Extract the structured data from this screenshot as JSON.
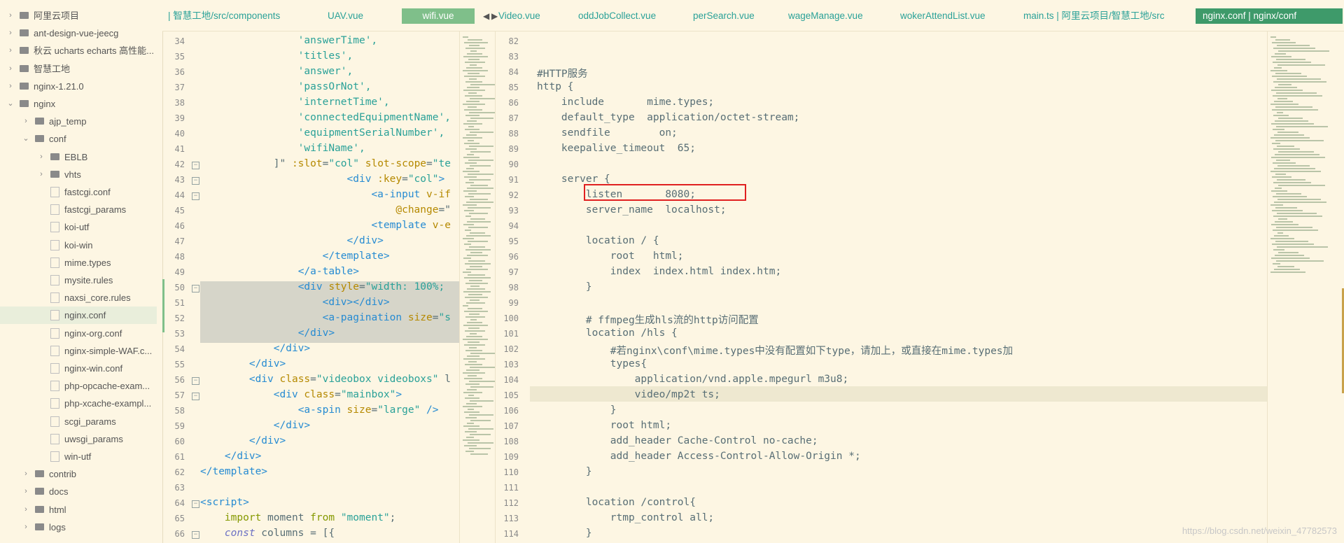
{
  "sidebar": {
    "items": [
      {
        "label": "阿里云项目",
        "depth": 0,
        "type": "folder",
        "expanded": false
      },
      {
        "label": "ant-design-vue-jeecg",
        "depth": 0,
        "type": "folder",
        "expanded": false
      },
      {
        "label": "秋云 ucharts echarts 高性能...",
        "depth": 0,
        "type": "folder",
        "expanded": false
      },
      {
        "label": "智慧工地",
        "depth": 0,
        "type": "folder",
        "expanded": false
      },
      {
        "label": "nginx-1.21.0",
        "depth": 0,
        "type": "folder",
        "expanded": false
      },
      {
        "label": "nginx",
        "depth": 0,
        "type": "folder",
        "expanded": true
      },
      {
        "label": "ajp_temp",
        "depth": 1,
        "type": "folder",
        "expanded": false
      },
      {
        "label": "conf",
        "depth": 1,
        "type": "folder",
        "expanded": true
      },
      {
        "label": "EBLB",
        "depth": 2,
        "type": "folder",
        "expanded": false
      },
      {
        "label": "vhts",
        "depth": 2,
        "type": "folder",
        "expanded": false
      },
      {
        "label": "fastcgi.conf",
        "depth": 2,
        "type": "file"
      },
      {
        "label": "fastcgi_params",
        "depth": 2,
        "type": "file"
      },
      {
        "label": "koi-utf",
        "depth": 2,
        "type": "file"
      },
      {
        "label": "koi-win",
        "depth": 2,
        "type": "file"
      },
      {
        "label": "mime.types",
        "depth": 2,
        "type": "file"
      },
      {
        "label": "mysite.rules",
        "depth": 2,
        "type": "file"
      },
      {
        "label": "naxsi_core.rules",
        "depth": 2,
        "type": "file"
      },
      {
        "label": "nginx.conf",
        "depth": 2,
        "type": "file",
        "selected": true
      },
      {
        "label": "nginx-org.conf",
        "depth": 2,
        "type": "file"
      },
      {
        "label": "nginx-simple-WAF.c...",
        "depth": 2,
        "type": "file"
      },
      {
        "label": "nginx-win.conf",
        "depth": 2,
        "type": "file"
      },
      {
        "label": "php-opcache-exam...",
        "depth": 2,
        "type": "file"
      },
      {
        "label": "php-xcache-exampl...",
        "depth": 2,
        "type": "file"
      },
      {
        "label": "scgi_params",
        "depth": 2,
        "type": "file"
      },
      {
        "label": "uwsgi_params",
        "depth": 2,
        "type": "file"
      },
      {
        "label": "win-utf",
        "depth": 2,
        "type": "file"
      },
      {
        "label": "contrib",
        "depth": 1,
        "type": "folder",
        "expanded": false
      },
      {
        "label": "docs",
        "depth": 1,
        "type": "folder",
        "expanded": false
      },
      {
        "label": "html",
        "depth": 1,
        "type": "folder",
        "expanded": false
      },
      {
        "label": "logs",
        "depth": 1,
        "type": "folder",
        "expanded": false
      }
    ]
  },
  "tabs": [
    {
      "label": "| 智慧工地/src/components",
      "state": "normal"
    },
    {
      "label": "UAV.vue",
      "state": "normal"
    },
    {
      "label": "wifi.vue",
      "state": "active"
    },
    {
      "label": "Video.vue",
      "state": "normal"
    },
    {
      "label": "oddJobCollect.vue",
      "state": "normal"
    },
    {
      "label": "perSearch.vue",
      "state": "normal"
    },
    {
      "label": "wageManage.vue",
      "state": "normal"
    },
    {
      "label": "wokerAttendList.vue",
      "state": "normal"
    },
    {
      "label": "main.ts | 阿里云项目/智慧工地/src",
      "state": "normal"
    },
    {
      "label": "nginx.conf | nginx/conf",
      "state": "active2"
    }
  ],
  "tab_nav": {
    "prev": "◀",
    "next": "▶"
  },
  "left_editor": {
    "lines": [
      {
        "n": "34",
        "tokens": [
          [
            "str",
            "                'answerTime',"
          ]
        ]
      },
      {
        "n": "35",
        "tokens": [
          [
            "str",
            "                'titles',"
          ]
        ]
      },
      {
        "n": "36",
        "tokens": [
          [
            "str",
            "                'answer',"
          ]
        ]
      },
      {
        "n": "37",
        "tokens": [
          [
            "str",
            "                'passOrNot',"
          ]
        ]
      },
      {
        "n": "38",
        "tokens": [
          [
            "str",
            "                'internetTime',"
          ]
        ]
      },
      {
        "n": "39",
        "tokens": [
          [
            "str",
            "                'connectedEquipmentName',"
          ]
        ]
      },
      {
        "n": "40",
        "tokens": [
          [
            "str",
            "                'equipmentSerialNumber',"
          ]
        ]
      },
      {
        "n": "41",
        "tokens": [
          [
            "str",
            "                'wifiName',"
          ]
        ]
      },
      {
        "n": "42",
        "fold": "-",
        "tokens": [
          [
            "plain",
            "            ]\" "
          ],
          [
            "attr",
            ":slot"
          ],
          [
            "plain",
            "="
          ],
          [
            "str",
            "\"col\""
          ],
          [
            "plain",
            " "
          ],
          [
            "attr",
            "slot-scope"
          ],
          [
            "plain",
            "="
          ],
          [
            "str",
            "\"te"
          ]
        ]
      },
      {
        "n": "43",
        "fold": "-",
        "tokens": [
          [
            "plain",
            "                        "
          ],
          [
            "tag",
            "<div"
          ],
          [
            "plain",
            " "
          ],
          [
            "attr",
            ":key"
          ],
          [
            "plain",
            "="
          ],
          [
            "str",
            "\"col\""
          ],
          [
            "tag",
            ">"
          ]
        ]
      },
      {
        "n": "44",
        "fold": "-",
        "tokens": [
          [
            "plain",
            "                            "
          ],
          [
            "tag",
            "<a-input"
          ],
          [
            "plain",
            " "
          ],
          [
            "attr",
            "v-if"
          ]
        ]
      },
      {
        "n": "45",
        "tokens": [
          [
            "plain",
            "                                "
          ],
          [
            "attr",
            "@change"
          ],
          [
            "plain",
            "=\""
          ]
        ]
      },
      {
        "n": "46",
        "tokens": [
          [
            "plain",
            "                            "
          ],
          [
            "tag",
            "<template"
          ],
          [
            "plain",
            " "
          ],
          [
            "attr",
            "v-e"
          ]
        ]
      },
      {
        "n": "47",
        "tokens": [
          [
            "plain",
            "                        "
          ],
          [
            "tag",
            "</div>"
          ]
        ]
      },
      {
        "n": "48",
        "tokens": [
          [
            "plain",
            "                    "
          ],
          [
            "tag",
            "</template>"
          ]
        ]
      },
      {
        "n": "49",
        "tokens": [
          [
            "plain",
            "                "
          ],
          [
            "tag",
            "</a-table>"
          ]
        ]
      },
      {
        "n": "50",
        "fold": "-",
        "tokens": [
          [
            "plain",
            "                "
          ],
          [
            "tag",
            "<div"
          ],
          [
            "plain",
            " "
          ],
          [
            "attr",
            "style"
          ],
          [
            "plain",
            "="
          ],
          [
            "str",
            "\"width: 100%;"
          ]
        ]
      },
      {
        "n": "51",
        "tokens": [
          [
            "plain",
            "                    "
          ],
          [
            "tag",
            "<div></div>"
          ]
        ]
      },
      {
        "n": "52",
        "tokens": [
          [
            "plain",
            "                    "
          ],
          [
            "tag",
            "<a-pagination"
          ],
          [
            "plain",
            " "
          ],
          [
            "attr",
            "size"
          ],
          [
            "plain",
            "="
          ],
          [
            "str",
            "\"s"
          ]
        ]
      },
      {
        "n": "53",
        "tokens": [
          [
            "plain",
            "                "
          ],
          [
            "tag",
            "</div>"
          ]
        ]
      },
      {
        "n": "54",
        "tokens": [
          [
            "plain",
            "            "
          ],
          [
            "tag",
            "</div>"
          ]
        ]
      },
      {
        "n": "55",
        "tokens": [
          [
            "plain",
            "        "
          ],
          [
            "tag",
            "</div>"
          ]
        ]
      },
      {
        "n": "56",
        "fold": "-",
        "tokens": [
          [
            "plain",
            "        "
          ],
          [
            "tag",
            "<div"
          ],
          [
            "plain",
            " "
          ],
          [
            "attr",
            "class"
          ],
          [
            "plain",
            "="
          ],
          [
            "str",
            "\"videobox videoboxs\""
          ],
          [
            "plain",
            " l"
          ]
        ]
      },
      {
        "n": "57",
        "fold": "-",
        "tokens": [
          [
            "plain",
            "            "
          ],
          [
            "tag",
            "<div"
          ],
          [
            "plain",
            " "
          ],
          [
            "attr",
            "class"
          ],
          [
            "plain",
            "="
          ],
          [
            "str",
            "\"mainbox\""
          ],
          [
            "tag",
            ">"
          ]
        ]
      },
      {
        "n": "58",
        "tokens": [
          [
            "plain",
            "                "
          ],
          [
            "tag",
            "<a-spin"
          ],
          [
            "plain",
            " "
          ],
          [
            "attr",
            "size"
          ],
          [
            "plain",
            "="
          ],
          [
            "str",
            "\"large\""
          ],
          [
            "plain",
            " "
          ],
          [
            "tag",
            "/>"
          ]
        ]
      },
      {
        "n": "59",
        "tokens": [
          [
            "plain",
            "            "
          ],
          [
            "tag",
            "</div>"
          ]
        ]
      },
      {
        "n": "60",
        "tokens": [
          [
            "plain",
            "        "
          ],
          [
            "tag",
            "</div>"
          ]
        ]
      },
      {
        "n": "61",
        "tokens": [
          [
            "plain",
            "    "
          ],
          [
            "tag",
            "</div>"
          ]
        ]
      },
      {
        "n": "62",
        "tokens": [
          [
            "tag",
            "</template>"
          ]
        ]
      },
      {
        "n": "63",
        "tokens": [
          [
            "plain",
            ""
          ]
        ]
      },
      {
        "n": "64",
        "fold": "-",
        "tokens": [
          [
            "tag",
            "<script>"
          ]
        ]
      },
      {
        "n": "65",
        "tokens": [
          [
            "plain",
            "    "
          ],
          [
            "kw",
            "import"
          ],
          [
            "plain",
            " moment "
          ],
          [
            "kw",
            "from"
          ],
          [
            "plain",
            " "
          ],
          [
            "str",
            "\"moment\""
          ],
          [
            "plain",
            ";"
          ]
        ]
      },
      {
        "n": "66",
        "fold": "-",
        "tokens": [
          [
            "plain",
            "    "
          ],
          [
            "kwi",
            "const"
          ],
          [
            "plain",
            " columns = [{"
          ]
        ]
      }
    ]
  },
  "right_editor": {
    "lines": [
      {
        "n": "82",
        "tokens": [
          [
            "plain",
            ""
          ]
        ]
      },
      {
        "n": "83",
        "tokens": [
          [
            "plain",
            ""
          ]
        ]
      },
      {
        "n": "84",
        "tokens": [
          [
            "cm",
            "#HTTP服务"
          ]
        ]
      },
      {
        "n": "85",
        "tokens": [
          [
            "plain",
            "http {"
          ]
        ]
      },
      {
        "n": "86",
        "tokens": [
          [
            "plain",
            "    include       mime.types;"
          ]
        ]
      },
      {
        "n": "87",
        "tokens": [
          [
            "plain",
            "    default_type  application/octet-stream;"
          ]
        ]
      },
      {
        "n": "88",
        "tokens": [
          [
            "plain",
            "    sendfile        on;"
          ]
        ]
      },
      {
        "n": "89",
        "tokens": [
          [
            "plain",
            "    keepalive_timeout  65;"
          ]
        ]
      },
      {
        "n": "90",
        "tokens": [
          [
            "plain",
            ""
          ]
        ]
      },
      {
        "n": "91",
        "tokens": [
          [
            "plain",
            "    server {"
          ]
        ]
      },
      {
        "n": "92",
        "tokens": [
          [
            "plain",
            "        listen       8080;"
          ]
        ]
      },
      {
        "n": "93",
        "tokens": [
          [
            "plain",
            "        server_name  localhost;"
          ]
        ]
      },
      {
        "n": "94",
        "tokens": [
          [
            "plain",
            ""
          ]
        ]
      },
      {
        "n": "95",
        "tokens": [
          [
            "plain",
            "        location / {"
          ]
        ]
      },
      {
        "n": "96",
        "tokens": [
          [
            "plain",
            "            root   html;"
          ]
        ]
      },
      {
        "n": "97",
        "tokens": [
          [
            "plain",
            "            index  index.html index.htm;"
          ]
        ]
      },
      {
        "n": "98",
        "tokens": [
          [
            "plain",
            "        }"
          ]
        ]
      },
      {
        "n": "99",
        "tokens": [
          [
            "plain",
            ""
          ]
        ]
      },
      {
        "n": "100",
        "tokens": [
          [
            "plain",
            "        # ffmpeg生成hls流的http访问配置"
          ]
        ]
      },
      {
        "n": "101",
        "tokens": [
          [
            "plain",
            "        location /hls {"
          ]
        ]
      },
      {
        "n": "102",
        "tokens": [
          [
            "plain",
            "            #若nginx\\conf\\mime.types中没有配置如下type，请加上，或直接在mime.types加"
          ]
        ]
      },
      {
        "n": "103",
        "tokens": [
          [
            "plain",
            "            types{"
          ]
        ]
      },
      {
        "n": "104",
        "tokens": [
          [
            "plain",
            "                application/vnd.apple.mpegurl m3u8;"
          ]
        ]
      },
      {
        "n": "105",
        "tokens": [
          [
            "plain",
            "                video/mp2t ts;"
          ]
        ]
      },
      {
        "n": "106",
        "tokens": [
          [
            "plain",
            "            }"
          ]
        ]
      },
      {
        "n": "107",
        "tokens": [
          [
            "plain",
            "            root html;"
          ]
        ]
      },
      {
        "n": "108",
        "tokens": [
          [
            "plain",
            "            add_header Cache-Control no-cache;"
          ]
        ]
      },
      {
        "n": "109",
        "tokens": [
          [
            "plain",
            "            add_header Access-Control-Allow-Origin *;"
          ]
        ]
      },
      {
        "n": "110",
        "tokens": [
          [
            "plain",
            "        }"
          ]
        ]
      },
      {
        "n": "111",
        "tokens": [
          [
            "plain",
            ""
          ]
        ]
      },
      {
        "n": "112",
        "tokens": [
          [
            "plain",
            "        location /control{"
          ]
        ]
      },
      {
        "n": "113",
        "tokens": [
          [
            "plain",
            "            rtmp_control all;"
          ]
        ]
      },
      {
        "n": "114",
        "tokens": [
          [
            "plain",
            "        }"
          ]
        ]
      }
    ]
  },
  "watermark": "https://blog.csdn.net/weixin_47782573",
  "colors": {
    "background": "#fdf6e3",
    "highlight_box": "#e02020",
    "active_tab": "#7fbf8a",
    "active_tab2": "#3e9a6a",
    "selection": "#cfcfc4"
  }
}
